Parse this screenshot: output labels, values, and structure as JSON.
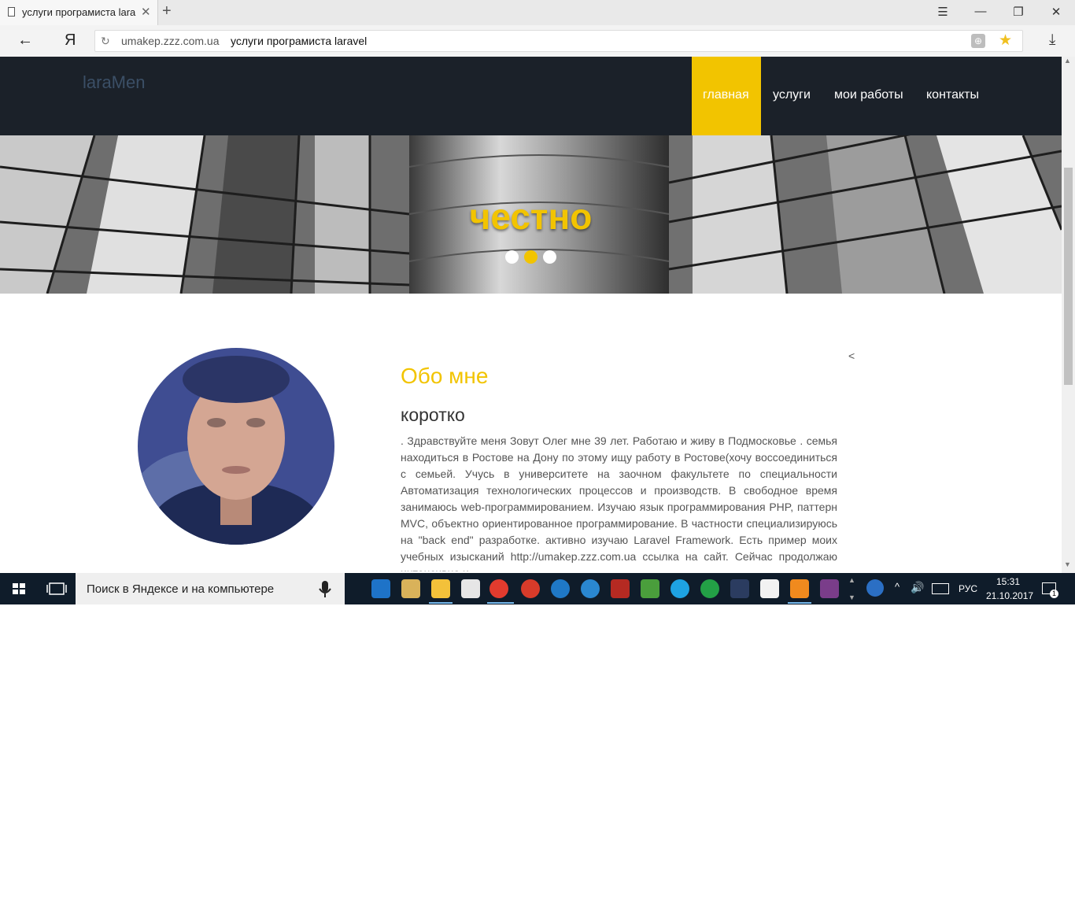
{
  "browser": {
    "tab_title": "услуги програмиста lara",
    "tab_close": "✕",
    "new_tab": "+",
    "window_buttons": {
      "menu": "☰",
      "minimize": "—",
      "restore": "❐",
      "close": "✕"
    },
    "back": "←",
    "yandex_button": "Я",
    "address_domain": "umakep.zzz.com.ua",
    "address_title": "услуги програмиста laravel",
    "reload": "↻",
    "protect": "⊕",
    "bookmark_star": "★",
    "download": "⤓"
  },
  "site": {
    "logo": "laraMen",
    "nav": [
      {
        "label": "главная",
        "active": true
      },
      {
        "label": "услуги",
        "active": false
      },
      {
        "label": "мои работы",
        "active": false
      },
      {
        "label": "контакты",
        "active": false
      }
    ],
    "slider": {
      "caption": "честно",
      "dots": 3,
      "active_dot": 2
    },
    "about": {
      "title": "Обо мне",
      "subtitle": "коротко",
      "text": ". Здравствуйте меня Зовут Олег мне 39 лет. Работаю и живу в Подмосковье . семья находиться в Ростове на Дону по этому ищу работу в Ростове(хочу воссоединиться с семьей. Учусь в университете на заочном факультете по специальности Автоматизация технологических процессов и производств. В свободное время занимаюсь web-программированием. Изучаю язык программирования PHP, паттерн MVC, объектно ориентированное программирование. В частности специализируюсь на \"back end\" разработке. активно изучаю Laravel Framework. Есть пример моих учебных изысканий http://umakep.zzz.com.ua ссылка на сайт. Сейчас продолжаю интенсивно и",
      "back_arrow": "<"
    }
  },
  "taskbar": {
    "search_placeholder": "Поиск в Яндексе и на компьютере",
    "mic": "🎤",
    "language": "РУС",
    "time": "15:31",
    "date": "21.10.2017",
    "notification_count": "1",
    "apps": [
      "edge-icon",
      "paint-icon",
      "explorer-icon",
      "yandex-icon",
      "yandex-browser-icon",
      "chrome-icon",
      "thunderbird-icon",
      "vpn-icon",
      "acrobat-icon",
      "chart-app-icon",
      "skype-icon",
      "money-app-icon",
      "media-player-icon",
      "mail-icon",
      "sublime-icon",
      "winrar-icon"
    ]
  },
  "colors": {
    "accent": "#f2c400",
    "header_bg": "#1b2129",
    "taskbar_bg": "#0f1c2a"
  }
}
